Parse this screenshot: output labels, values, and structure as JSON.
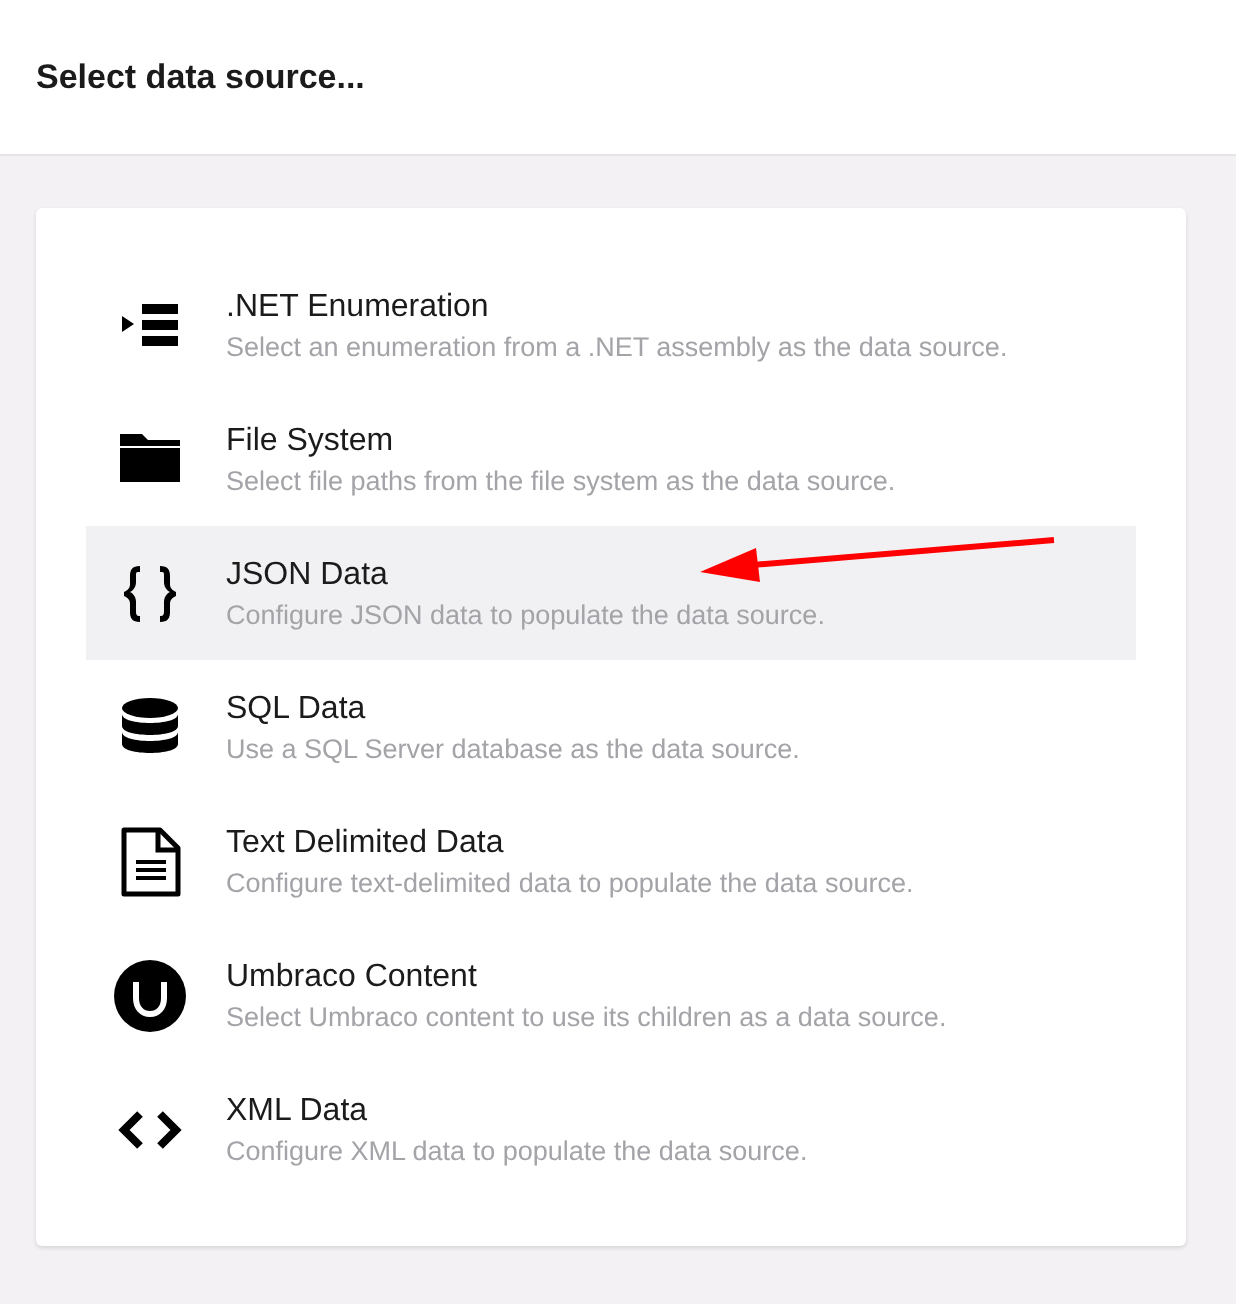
{
  "header": {
    "title": "Select data source..."
  },
  "sources": [
    {
      "name": ".NET Enumeration",
      "description": "Select an enumeration from a .NET assembly as the data source.",
      "selected": false
    },
    {
      "name": "File System",
      "description": "Select file paths from the file system as the data source.",
      "selected": false
    },
    {
      "name": "JSON Data",
      "description": "Configure JSON data to populate the data source.",
      "selected": true
    },
    {
      "name": "SQL Data",
      "description": "Use a SQL Server database as the data source.",
      "selected": false
    },
    {
      "name": "Text Delimited Data",
      "description": "Configure text-delimited data to populate the data source.",
      "selected": false
    },
    {
      "name": "Umbraco Content",
      "description": "Select Umbraco content to use its children as a data source.",
      "selected": false
    },
    {
      "name": "XML Data",
      "description": "Configure XML data to populate the data source.",
      "selected": false
    }
  ]
}
